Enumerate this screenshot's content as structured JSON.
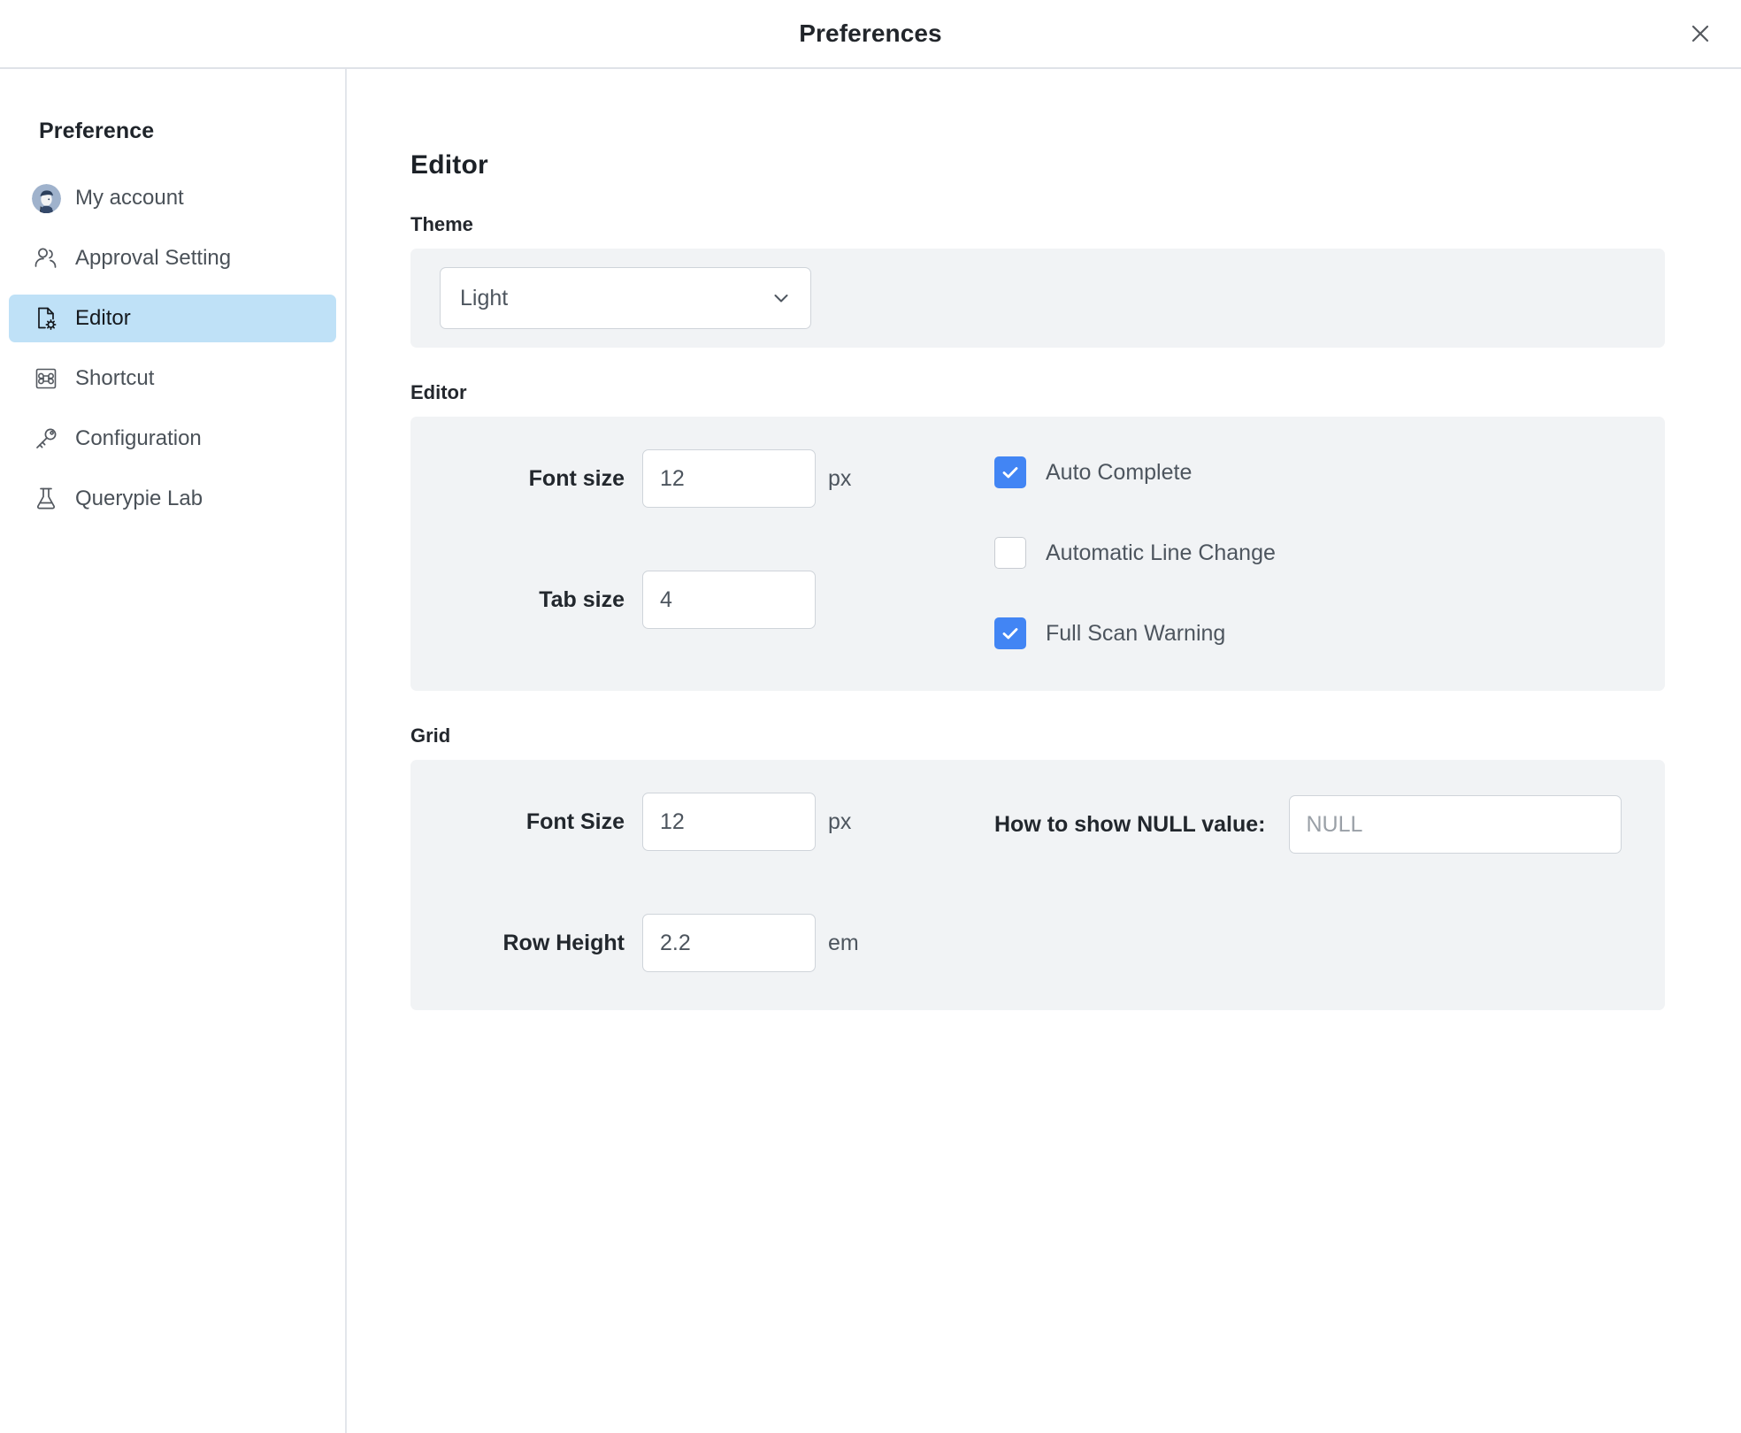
{
  "window": {
    "title": "Preferences",
    "close_icon": "close-icon"
  },
  "sidebar": {
    "heading": "Preference",
    "items": [
      {
        "label": "My account",
        "icon": "avatar-icon",
        "selected": false
      },
      {
        "label": "Approval Setting",
        "icon": "users-icon",
        "selected": false
      },
      {
        "label": "Editor",
        "icon": "file-settings-icon",
        "selected": true
      },
      {
        "label": "Shortcut",
        "icon": "command-key-icon",
        "selected": false
      },
      {
        "label": "Configuration",
        "icon": "key-icon",
        "selected": false
      },
      {
        "label": "Querypie Lab",
        "icon": "flask-icon",
        "selected": false
      }
    ]
  },
  "main": {
    "title": "Editor",
    "theme": {
      "section_label": "Theme",
      "select_value": "Light",
      "select_options": [
        "Light"
      ],
      "chevron_icon": "chevron-down-icon"
    },
    "editor": {
      "section_label": "Editor",
      "fields": [
        {
          "label": "Font size",
          "value": "12",
          "unit": "px"
        },
        {
          "label": "Tab size",
          "value": "4",
          "unit": ""
        }
      ],
      "checkboxes": [
        {
          "label": "Auto Complete",
          "checked": true
        },
        {
          "label": "Automatic Line Change",
          "checked": false
        },
        {
          "label": "Full Scan Warning",
          "checked": true
        }
      ]
    },
    "grid": {
      "section_label": "Grid",
      "fields": [
        {
          "label": "Font Size",
          "value": "12",
          "unit": "px"
        },
        {
          "label": "Row Height",
          "value": "2.2",
          "unit": "em"
        }
      ],
      "null_value": {
        "label": "How to show NULL value:",
        "placeholder": "NULL",
        "value": ""
      }
    }
  },
  "colors": {
    "accent_checkbox": "#4285f4",
    "selected_nav_bg": "#bfe1f7",
    "panel_bg": "#f1f3f5",
    "border": "#cfd4da",
    "text_primary": "#22272d",
    "text_secondary": "#4d555e",
    "placeholder": "#9aa0a7"
  }
}
